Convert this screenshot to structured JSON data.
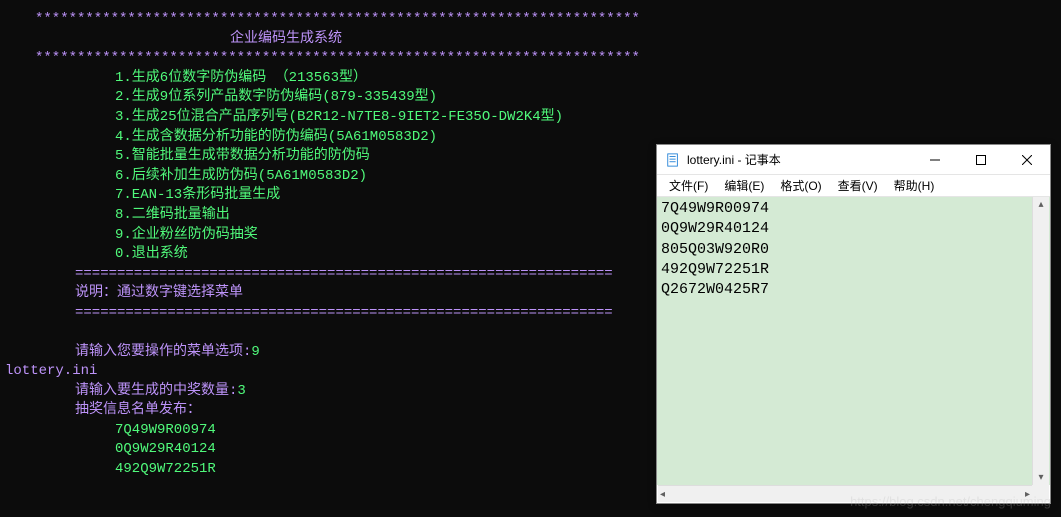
{
  "console": {
    "stars": "************************************************************************",
    "title": "企业编码生成系统",
    "menu": [
      "1.生成6位数字防伪编码   （213563型）",
      "2.生成9位系列产品数字防伪编码(879-335439型)",
      "3.生成25位混合产品序列号(B2R12-N7TE8-9IET2-FE35O-DW2K4型)",
      "4.生成含数据分析功能的防伪编码(5A61M0583D2)",
      "5.智能批量生成带数据分析功能的防伪码",
      "6.后续补加生成防伪码(5A61M0583D2)",
      "7.EAN-13条形码批量生成",
      "8.二维码批量输出",
      "9.企业粉丝防伪码抽奖",
      "0.退出系统"
    ],
    "equals": "================================================================",
    "instruction": "说明：通过数字键选择菜单",
    "prompt1": "请输入您要操作的菜单选项:",
    "input1": "9",
    "file": "lottery.ini",
    "prompt2": "请输入要生成的中奖数量:",
    "input2": "3",
    "result_header": "抽奖信息名单发布：",
    "results": [
      "7Q49W9R00974",
      "0Q9W29R40124",
      "492Q9W72251R"
    ]
  },
  "notepad": {
    "title": "lottery.ini - 记事本",
    "menus": {
      "file": "文件(F)",
      "edit": "编辑(E)",
      "format": "格式(O)",
      "view": "查看(V)",
      "help": "帮助(H)"
    },
    "content": [
      "7Q49W9R00974",
      "0Q9W29R40124",
      "805Q03W920R0",
      "492Q9W72251R",
      "Q2672W0425R7"
    ]
  },
  "watermark": "https://blog.csdn.net/chengqiuming"
}
